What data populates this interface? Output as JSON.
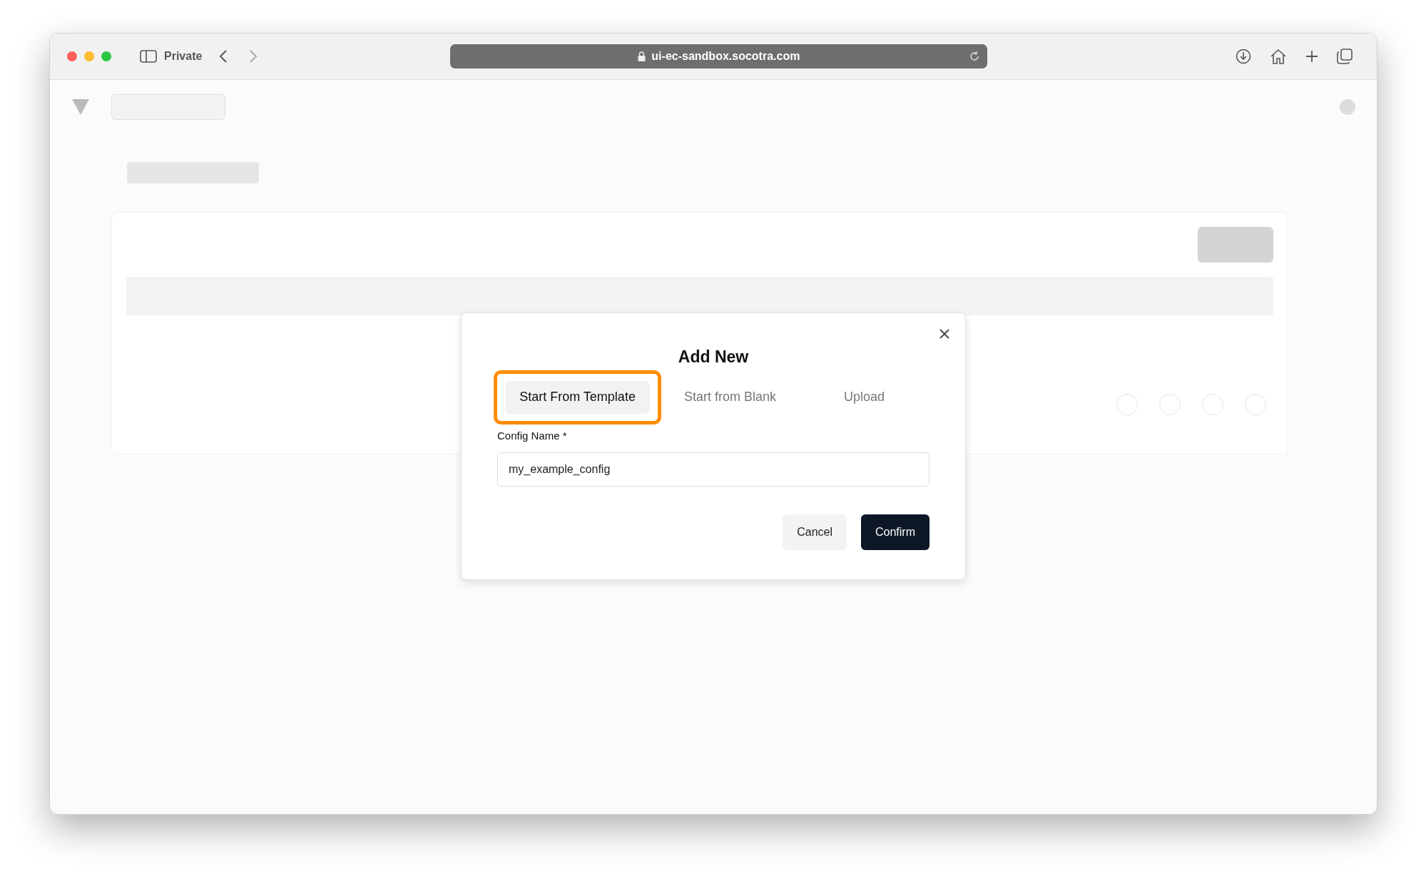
{
  "browser": {
    "mode_label": "Private",
    "address": "ui-ec-sandbox.socotra.com"
  },
  "dialog": {
    "title": "Add New",
    "tabs": [
      {
        "label": "Start From Template",
        "selected": true,
        "highlighted": true
      },
      {
        "label": "Start from Blank",
        "selected": false,
        "highlighted": false
      },
      {
        "label": "Upload",
        "selected": false,
        "highlighted": false
      }
    ],
    "field": {
      "label": "Config Name *",
      "value": "my_example_config"
    },
    "buttons": [
      {
        "label": "Cancel",
        "kind": "secondary"
      },
      {
        "label": "Confirm",
        "kind": "primary"
      }
    ]
  }
}
